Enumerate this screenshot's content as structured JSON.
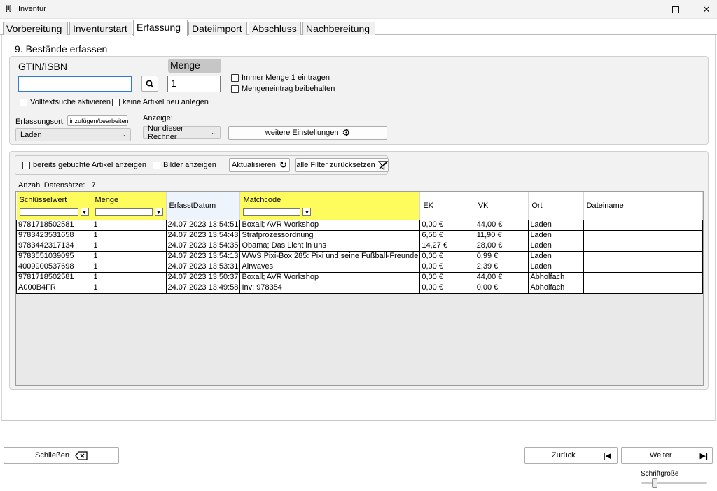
{
  "window": {
    "title": "Inventur",
    "app_icon": "barcode-icon"
  },
  "tabs": [
    {
      "label": "Vorbereitung"
    },
    {
      "label": "Inventurstart"
    },
    {
      "label": "Erfassung"
    },
    {
      "label": "Dateiimport"
    },
    {
      "label": "Abschluss"
    },
    {
      "label": "Nachbereitung"
    }
  ],
  "active_tab": "Erfassung",
  "section_title": "9. Bestände erfassen",
  "form": {
    "gtin_label": "GTIN/ISBN",
    "gtin_value": "",
    "menge_label": "Menge",
    "menge_value": "1",
    "cb_immer_menge": "Immer Menge 1 eintragen",
    "cb_mengeneintrag": "Mengeneintrag beibehalten",
    "cb_volltext": "Volltextsuche aktivieren",
    "cb_keine_artikel": "keine Artikel neu anlegen",
    "erfassungsort_label": "Erfassungsort:",
    "hinzufuegen_button": "hinzufügen/bearbeiten",
    "erfassungsort_value": "Laden",
    "anzeige_label": "Anzeige:",
    "anzeige_value": "Nur dieser Rechner",
    "weitere_button": "weitere Einstellungen"
  },
  "filters": {
    "cb_gebuchte": "bereits gebuchte Artikel anzeigen",
    "cb_bilder": "Bilder anzeigen",
    "aktualisieren_button": "Aktualisieren",
    "reset_button": "alle Filter zurücksetzen"
  },
  "record_count_label": "Anzahl Datensätze:",
  "record_count": "7",
  "table": {
    "columns": [
      "Schlüsselwert",
      "Menge",
      "ErfasstDatum",
      "Matchcode",
      "EK",
      "VK",
      "Ort",
      "Dateiname"
    ],
    "rows": [
      [
        "9781718502581",
        "1",
        "24.07.2023 13:54:51",
        "Boxall; AVR Workshop",
        "0,00 €",
        "44,00 €",
        "Laden",
        ""
      ],
      [
        "9783423531658",
        "1",
        "24.07.2023 13:54:43",
        "Strafprozessordnung",
        "6,56 €",
        "11,90 €",
        "Laden",
        ""
      ],
      [
        "9783442317134",
        "1",
        "24.07.2023 13:54:35",
        "Obama; Das Licht in uns",
        "14,27 €",
        "28,00 €",
        "Laden",
        ""
      ],
      [
        "9783551039095",
        "1",
        "24.07.2023 13:54:13",
        "WWS Pixi-Box 285: Pixi und seine Fußball-Freunde",
        "0,00 €",
        "0,99 €",
        "Laden",
        ""
      ],
      [
        "4009900537698",
        "1",
        "24.07.2023 13:53:31",
        "Airwaves",
        "0,00 €",
        "2,39 €",
        "Laden",
        ""
      ],
      [
        "9781718502581",
        "1",
        "24.07.2023 13:50:37",
        "Boxall; AVR Workshop",
        "0,00 €",
        "44,00 €",
        "Abholfach",
        ""
      ],
      [
        "A000B4FR",
        "1",
        "24.07.2023 13:49:58",
        "Inv: 978354",
        "0,00 €",
        "0,00 €",
        "Abholfach",
        ""
      ]
    ]
  },
  "footer": {
    "schliessen": "Schließen",
    "zurueck": "Zurück",
    "weiter": "Weiter",
    "schriftgroesse": "Schriftgröße"
  },
  "colors": {
    "filter_header": "#fefb5c",
    "focus_border": "#2d7bd6"
  }
}
